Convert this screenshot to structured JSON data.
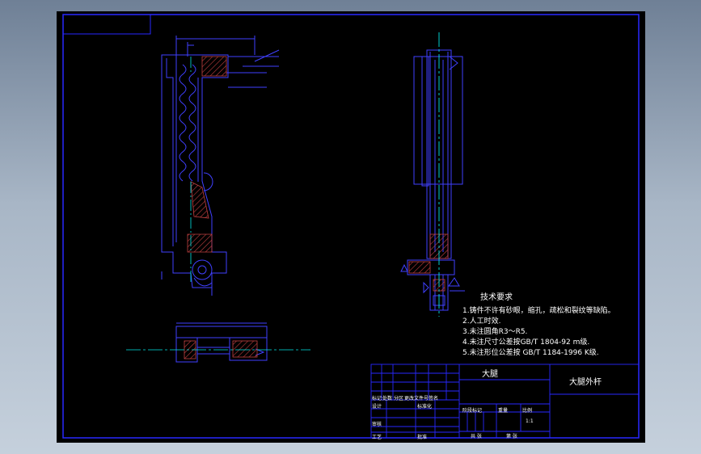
{
  "colors": {
    "background": "#000000",
    "border": "#2929ff",
    "outline": "#4040ff",
    "centerline": "#00e5e5",
    "hatch": "#c04040",
    "text": "#ffffff"
  },
  "technical_requirements": {
    "title": "技术要求",
    "items": [
      "1.铸件不许有砂眼，缩孔，疏松和裂纹等缺陷。",
      "2.人工时效.",
      "3.未注圆角R3～R5.",
      "4.未注尺寸公差按GB/T 1804-92 m级.",
      "5.未注形位公差按 GB/T 1184-1996 K级."
    ]
  },
  "title_block": {
    "assembly_name": "大腿",
    "part_name": "大腿外杆",
    "row_labels": [
      "标记",
      "处数",
      "分区",
      "更改文件号",
      "签名",
      "设计",
      "审核",
      "工艺",
      "标准化",
      "批准"
    ],
    "stage_label": "阶段标记",
    "weight_label": "重量",
    "scale_label": "比例",
    "scale_value": "1:1",
    "sheet_total": "共 张",
    "sheet_num": "第 张"
  }
}
